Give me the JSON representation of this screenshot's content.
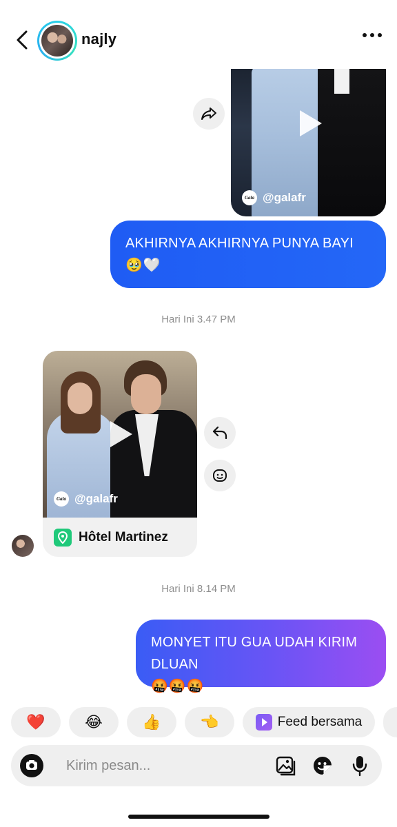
{
  "header": {
    "username": "najly"
  },
  "messages": {
    "shared_post_1": {
      "source_handle": "@galafr",
      "source_logo": "Gala"
    },
    "outgoing_1": {
      "text": "AKHIRNYA AKHIRNYA PUNYA BAYI",
      "emojis": "🥹🤍"
    },
    "timestamp_1": "Hari Ini 3.47 PM",
    "shared_post_2": {
      "source_handle": "@galafr",
      "source_logo": "Gala",
      "location": "Hôtel Martinez"
    },
    "timestamp_2": "Hari Ini 8.14 PM",
    "outgoing_2": {
      "text": "MONYET ITU GUA UDAH KIRIM DLUAN",
      "emojis": "🤬🤬🤬"
    }
  },
  "quick_replies": {
    "items": [
      "❤️",
      "😂",
      "👍",
      "👈"
    ],
    "feed_label": "Feed bersama"
  },
  "composer": {
    "placeholder": "Kirim pesan..."
  },
  "colors": {
    "bubble_blue": "#1f5cf4",
    "bubble_gradient_end": "#9b4ef2",
    "story_ring": "#2ad0e8",
    "chip_bg": "#efefef"
  }
}
